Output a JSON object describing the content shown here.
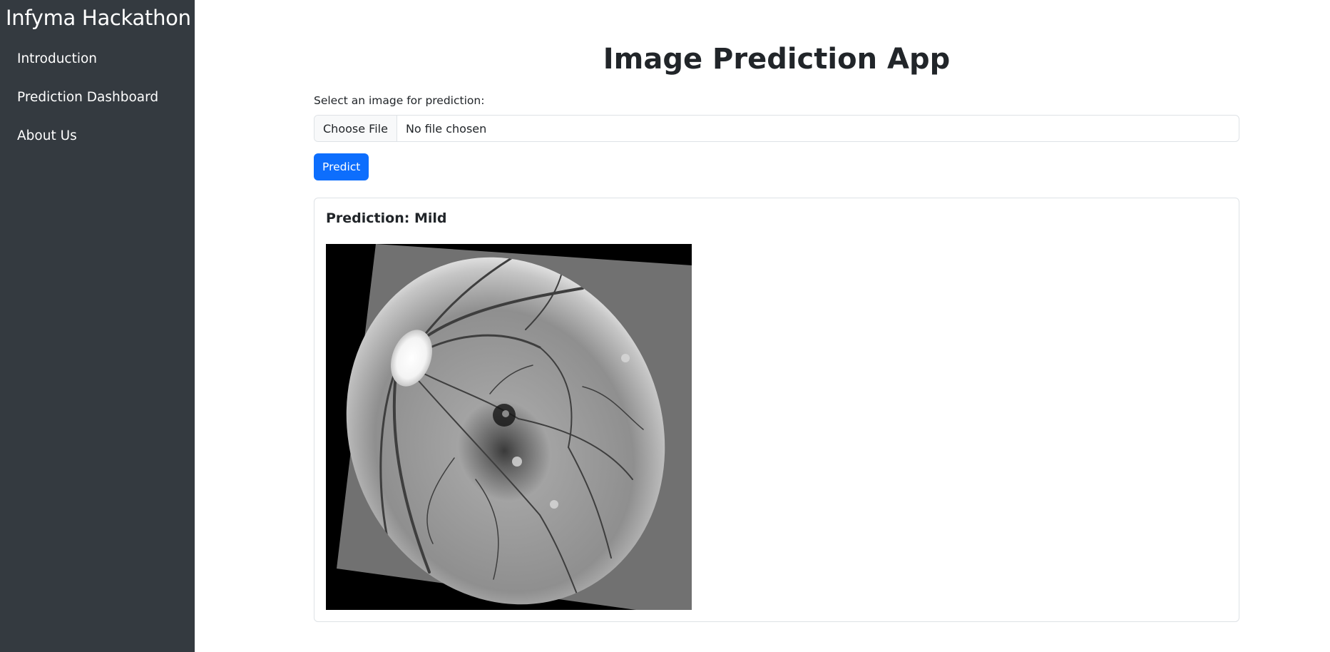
{
  "sidebar": {
    "brand": "Infyma Hackathon",
    "items": [
      {
        "label": "Introduction"
      },
      {
        "label": "Prediction Dashboard"
      },
      {
        "label": "About Us"
      }
    ]
  },
  "main": {
    "title": "Image Prediction App",
    "form": {
      "label": "Select an image for prediction:",
      "choose_file_label": "Choose File",
      "file_status": "No file chosen",
      "predict_label": "Predict"
    },
    "result": {
      "title": "Prediction: Mild",
      "image_name": "retina-fundus-image"
    }
  },
  "colors": {
    "sidebar_bg": "#343a40",
    "primary": "#0d6efd",
    "border": "#dee2e6"
  }
}
